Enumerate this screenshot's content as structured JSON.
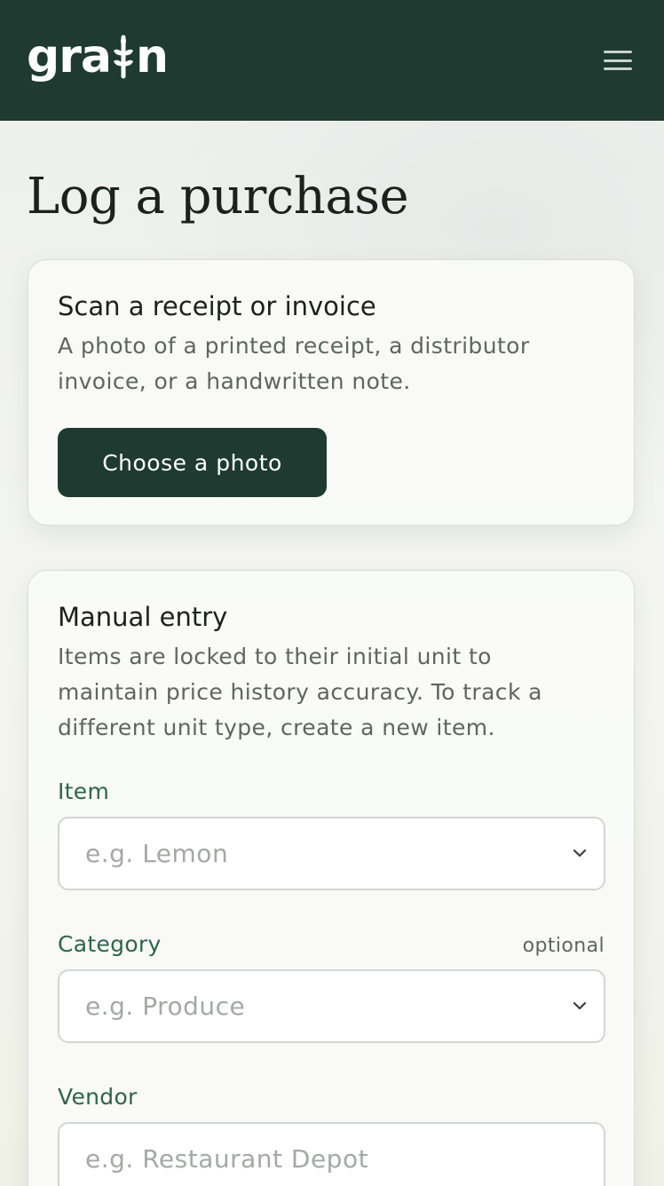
{
  "header": {
    "logo_text_left": "gra",
    "logo_text_right": "n",
    "menu_icon": "hamburger-menu-icon",
    "background_color": "#1e3a31"
  },
  "page": {
    "title": "Log a purchase"
  },
  "scan_card": {
    "title": "Scan a receipt or invoice",
    "description_line1": "A photo of a printed receipt, a distributor",
    "description_line2": "invoice, or a handwritten note.",
    "button_label": "Choose a photo"
  },
  "manual_card": {
    "title": "Manual entry",
    "description_line1": "Items are locked to their initial unit to",
    "description_line2": "maintain price history accuracy. To track a",
    "description_line3": "different unit type, create a new item.",
    "fields": {
      "item": {
        "label": "Item",
        "placeholder": "e.g. Lemon",
        "icon": "chevron-down-icon"
      },
      "category": {
        "label": "Category",
        "optional": "optional",
        "placeholder": "e.g. Produce",
        "icon": "chevron-down-icon"
      },
      "vendor": {
        "label": "Vendor",
        "placeholder": "e.g. Restaurant Depot"
      }
    }
  },
  "colors": {
    "primary": "#1e3a31",
    "label_green": "#2e6450",
    "muted_text": "#5e6661",
    "placeholder": "#a3a9a5"
  }
}
